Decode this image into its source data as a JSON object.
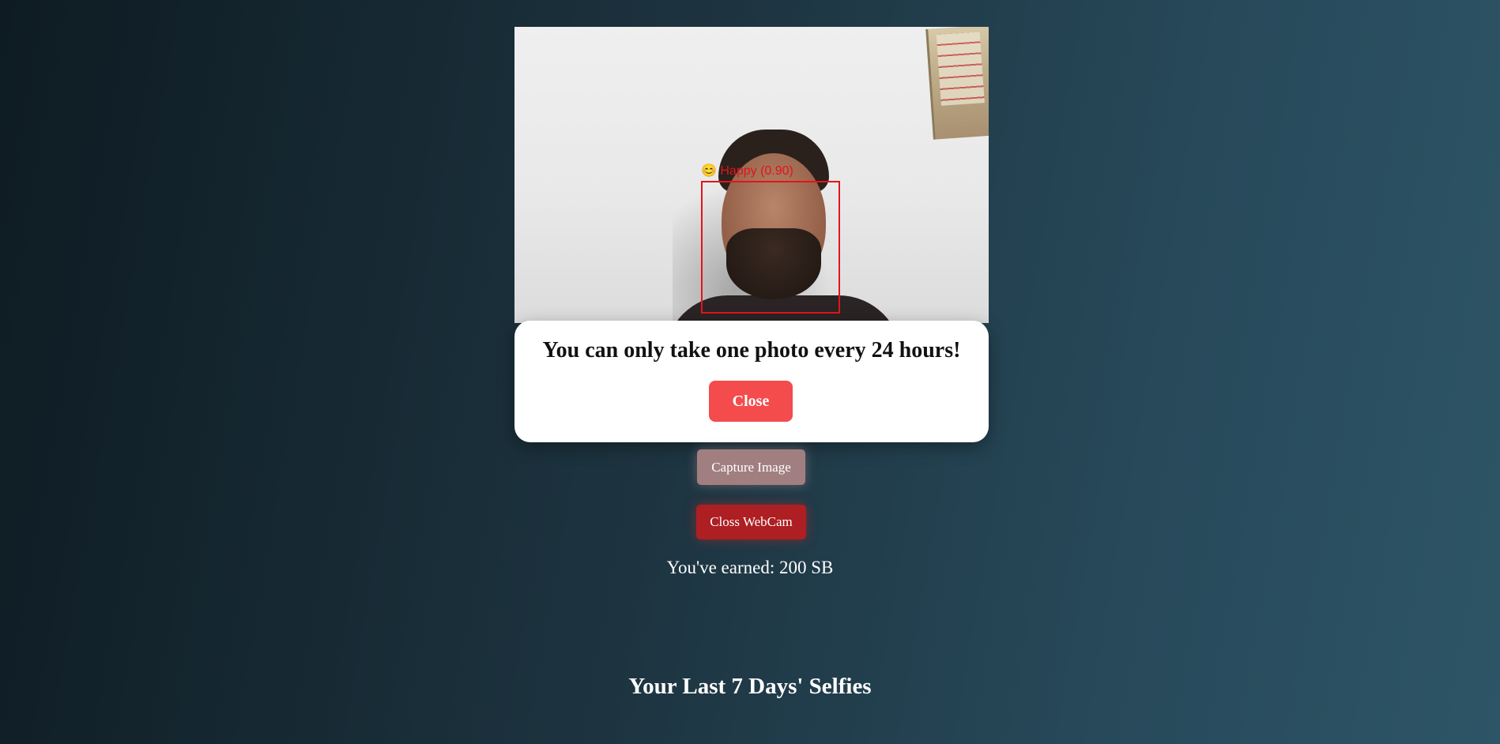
{
  "webcam": {
    "detection": {
      "emoji": "😊",
      "label": "Happy (0.90)"
    }
  },
  "modal": {
    "message": "You can only take one photo every 24 hours!",
    "close_label": "Close"
  },
  "actions": {
    "capture_label": "Capture Image",
    "close_webcam_label": "Closs WebCam"
  },
  "earned": {
    "text": "You've earned: 200 SB"
  },
  "selfies": {
    "title": "Your Last 7 Days' Selfies"
  },
  "colors": {
    "close_button": "#f44b4d",
    "capture_button": "#a17f80",
    "close_webcam_button": "#ad1f22",
    "detection_box": "#e3141b"
  }
}
